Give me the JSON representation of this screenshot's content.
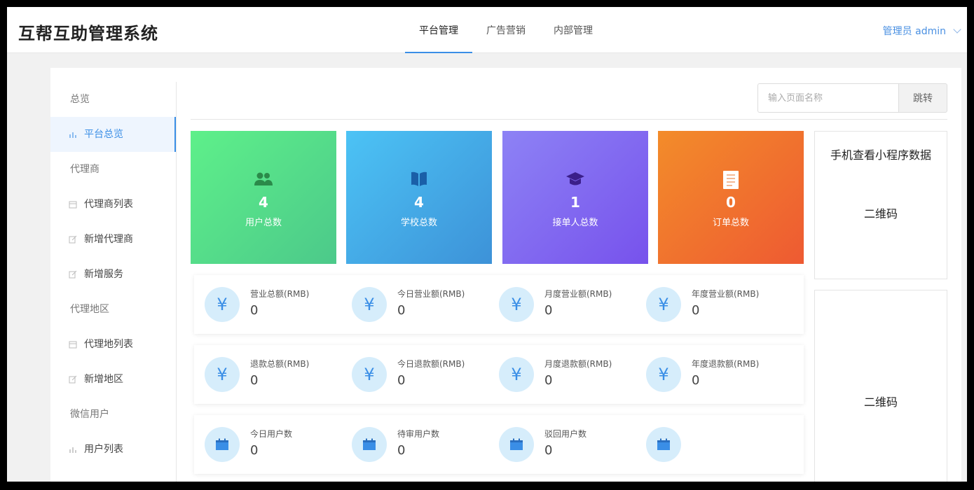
{
  "header": {
    "title": "互帮互助管理系统",
    "tabs": [
      {
        "label": "平台管理",
        "active": true
      },
      {
        "label": "广告营销",
        "active": false
      },
      {
        "label": "内部管理",
        "active": false
      }
    ],
    "user_label": "管理员 admin"
  },
  "sidebar": {
    "items": [
      {
        "type": "group",
        "label": "总览"
      },
      {
        "type": "item",
        "label": "平台总览",
        "icon": "bar-chart-icon",
        "active": true
      },
      {
        "type": "group",
        "label": "代理商"
      },
      {
        "type": "item",
        "label": "代理商列表",
        "icon": "calendar-icon"
      },
      {
        "type": "item",
        "label": "新增代理商",
        "icon": "edit-icon"
      },
      {
        "type": "item",
        "label": "新增服务",
        "icon": "edit-icon"
      },
      {
        "type": "group",
        "label": "代理地区"
      },
      {
        "type": "item",
        "label": "代理地列表",
        "icon": "calendar-icon"
      },
      {
        "type": "item",
        "label": "新增地区",
        "icon": "edit-icon"
      },
      {
        "type": "group",
        "label": "微信用户"
      },
      {
        "type": "item",
        "label": "用户列表",
        "icon": "bar-chart-icon"
      }
    ]
  },
  "search": {
    "placeholder": "输入页面名称",
    "button_label": "跳转"
  },
  "tiles": [
    {
      "value": "4",
      "label": "用户总数",
      "icon": "users-icon",
      "color": "#5ef08a"
    },
    {
      "value": "4",
      "label": "学校总数",
      "icon": "book-icon",
      "color": "#4cc3f5"
    },
    {
      "value": "1",
      "label": "接单人总数",
      "icon": "graduation-cap-icon",
      "color": "#8d82f5"
    },
    {
      "value": "0",
      "label": "订单总数",
      "icon": "document-icon",
      "color": "#f38c2a"
    }
  ],
  "revenue_stats": [
    {
      "label": "营业总额(RMB)",
      "value": "0",
      "icon": "yen-icon"
    },
    {
      "label": "今日营业额(RMB)",
      "value": "0",
      "icon": "yen-icon"
    },
    {
      "label": "月度营业额(RMB)",
      "value": "0",
      "icon": "yen-icon"
    },
    {
      "label": "年度营业额(RMB)",
      "value": "0",
      "icon": "yen-icon"
    }
  ],
  "refund_stats": [
    {
      "label": "退款总额(RMB)",
      "value": "0",
      "icon": "yen-icon"
    },
    {
      "label": "今日退款额(RMB)",
      "value": "0",
      "icon": "yen-icon"
    },
    {
      "label": "月度退款额(RMB)",
      "value": "0",
      "icon": "yen-icon"
    },
    {
      "label": "年度退款额(RMB)",
      "value": "0",
      "icon": "yen-icon"
    }
  ],
  "user_stats": [
    {
      "label": "今日用户数",
      "value": "0",
      "icon": "calendar-icon"
    },
    {
      "label": "待审用户数",
      "value": "0",
      "icon": "calendar-icon"
    },
    {
      "label": "驳回用户数",
      "value": "0",
      "icon": "calendar-icon"
    },
    {
      "label": "",
      "value": "",
      "icon": "calendar-icon"
    }
  ],
  "qr_panels": [
    {
      "title": "手机查看小程序数据",
      "code_label": "二维码"
    },
    {
      "title": "",
      "code_label": "二维码"
    }
  ]
}
